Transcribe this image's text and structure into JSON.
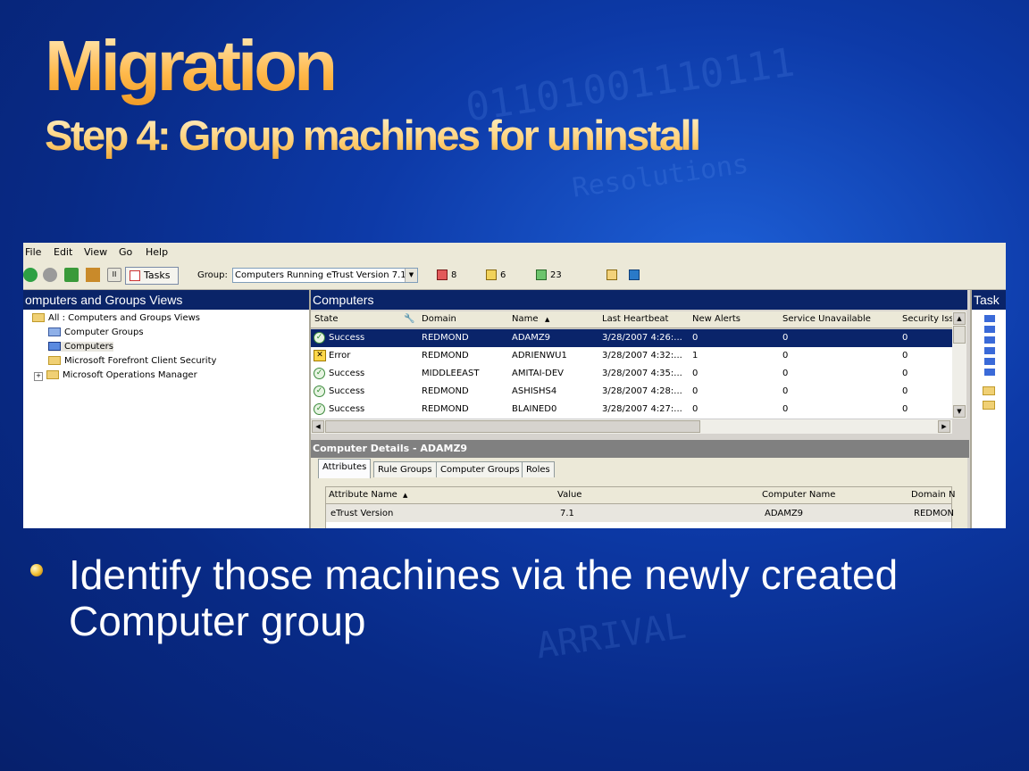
{
  "slide": {
    "title": "Migration",
    "subtitle": "Step 4: Group machines for uninstall",
    "bullet": "Identify those machines via the newly created Computer group"
  },
  "menu": [
    "File",
    "Edit",
    "View",
    "Go",
    "Help"
  ],
  "toolbar": {
    "tasks_label": "Tasks",
    "group_label": "Group:",
    "group_value": "Computers Running eTrust Version 7.1",
    "count_error": "8",
    "count_warning": "6",
    "count_ok": "23"
  },
  "left_pane": {
    "header": "omputers and Groups Views",
    "tree": [
      "All : Computers and Groups Views",
      "Computer Groups",
      "Computers",
      "Microsoft Forefront Client Security",
      "Microsoft Operations Manager"
    ]
  },
  "computers": {
    "header": "Computers",
    "columns": [
      "State",
      "Domain",
      "Name",
      "Last Heartbeat",
      "New Alerts",
      "Service Unavailable",
      "Security Iss"
    ],
    "rows": [
      {
        "state": "Success",
        "domain": "REDMOND",
        "name": "ADAMZ9",
        "heartbeat": "3/28/2007  4:26:...",
        "alerts": "0",
        "unavailable": "0",
        "security": "0",
        "status": "ok"
      },
      {
        "state": "Error",
        "domain": "REDMOND",
        "name": "ADRIENWU1",
        "heartbeat": "3/28/2007  4:32:...",
        "alerts": "1",
        "unavailable": "0",
        "security": "0",
        "status": "error"
      },
      {
        "state": "Success",
        "domain": "MIDDLEEAST",
        "name": "AMITAI-DEV",
        "heartbeat": "3/28/2007  4:35:...",
        "alerts": "0",
        "unavailable": "0",
        "security": "0",
        "status": "ok"
      },
      {
        "state": "Success",
        "domain": "REDMOND",
        "name": "ASHISHS4",
        "heartbeat": "3/28/2007  4:28:...",
        "alerts": "0",
        "unavailable": "0",
        "security": "0",
        "status": "ok"
      },
      {
        "state": "Success",
        "domain": "REDMOND",
        "name": "BLAINED0",
        "heartbeat": "3/28/2007  4:27:...",
        "alerts": "0",
        "unavailable": "0",
        "security": "0",
        "status": "ok"
      }
    ]
  },
  "details": {
    "header": "Computer Details - ADAMZ9",
    "tabs": [
      "Attributes",
      "Rule Groups",
      "Computer Groups",
      "Roles"
    ],
    "columns": [
      "Attribute Name",
      "Value",
      "Computer Name",
      "Domain N"
    ],
    "row": {
      "attribute": "eTrust Version",
      "value": "7.1",
      "computer": "ADAMZ9",
      "domain": "REDMON"
    }
  },
  "right_pane": {
    "header": "Task"
  },
  "colors": {
    "title_gold": "#ffb84a",
    "selection": "#0a246a",
    "pane_header": "#0a2468",
    "background": "#0d3aa8"
  }
}
